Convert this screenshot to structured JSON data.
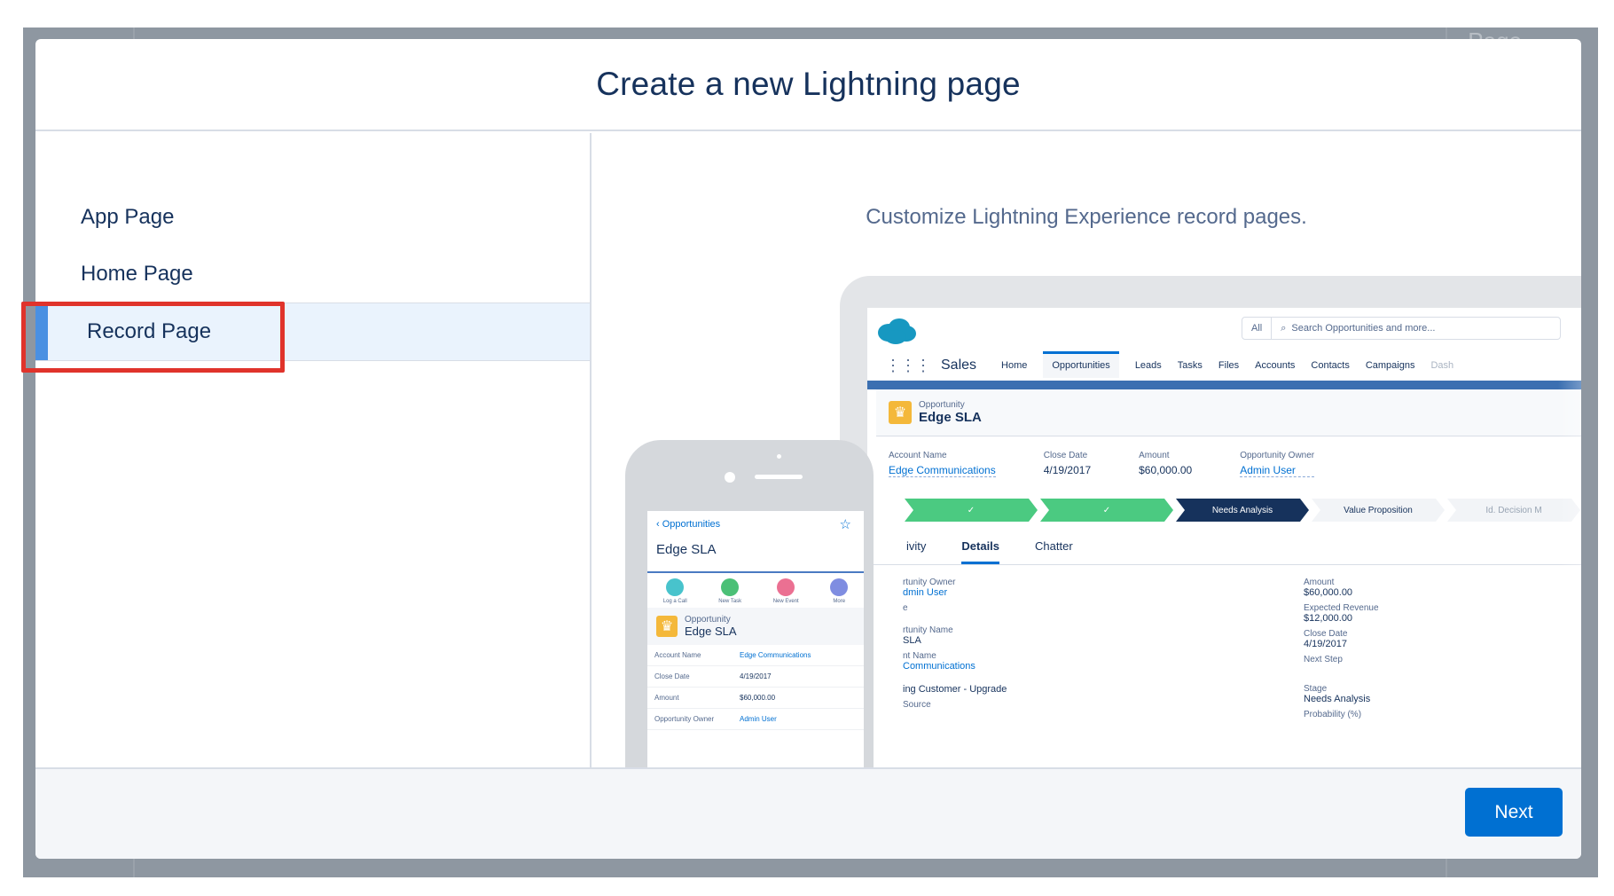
{
  "modal": {
    "title": "Create a new Lightning page",
    "background_partial_text": "Page"
  },
  "nav": {
    "items": [
      {
        "label": "App Page",
        "selected": false
      },
      {
        "label": "Home Page",
        "selected": false
      },
      {
        "label": "Record Page",
        "selected": true
      }
    ]
  },
  "preview": {
    "description": "Customize Lightning Experience record pages.",
    "desktop": {
      "search_scope": "All",
      "search_placeholder": "Search Opportunities and more...",
      "app_name": "Sales",
      "tabs": [
        "Home",
        "Opportunities",
        "Leads",
        "Tasks",
        "Files",
        "Accounts",
        "Contacts",
        "Campaigns",
        "Dash"
      ],
      "record_type": "Opportunity",
      "record_name": "Edge SLA",
      "highlight_fields": [
        {
          "label": "Account Name",
          "value": "Edge Communications"
        },
        {
          "label": "Close Date",
          "value": "4/19/2017"
        },
        {
          "label": "Amount",
          "value": "$60,000.00"
        },
        {
          "label": "Opportunity Owner",
          "value": "Admin User"
        }
      ],
      "path": [
        {
          "label": "✓",
          "state": "done"
        },
        {
          "label": "✓",
          "state": "done"
        },
        {
          "label": "Needs Analysis",
          "state": "current"
        },
        {
          "label": "Value Proposition",
          "state": "todo"
        },
        {
          "label": "Id. Decision M",
          "state": "todo"
        }
      ],
      "detail_tabs": [
        "ivity",
        "Details",
        "Chatter"
      ],
      "left_fields": [
        {
          "label": "rtunity Owner",
          "value": "dmin User"
        },
        {
          "label": "e",
          "value": ""
        },
        {
          "label": "rtunity Name",
          "value": "SLA"
        },
        {
          "label": "nt Name",
          "value": "Communications"
        },
        {
          "label": "",
          "value": "ing Customer - Upgrade"
        },
        {
          "label": "Source",
          "value": ""
        }
      ],
      "right_fields": [
        {
          "label": "Amount",
          "value": "$60,000.00"
        },
        {
          "label": "Expected Revenue",
          "value": "$12,000.00"
        },
        {
          "label": "Close Date",
          "value": "4/19/2017"
        },
        {
          "label": "Next Step",
          "value": ""
        },
        {
          "label": "Stage",
          "value": "Needs Analysis"
        },
        {
          "label": "Probability (%)",
          "value": ""
        }
      ]
    },
    "phone": {
      "back_label": "Opportunities",
      "title": "Edge SLA",
      "actions": [
        {
          "label": "Log a Call",
          "color": "#48c3cc"
        },
        {
          "label": "New Task",
          "color": "#4bc076"
        },
        {
          "label": "New Event",
          "color": "#eb7092"
        },
        {
          "label": "More",
          "color": "#7f8de1"
        }
      ],
      "record_type": "Opportunity",
      "record_name": "Edge SLA",
      "rows": [
        {
          "label": "Account Name",
          "value": "Edge Communications"
        },
        {
          "label": "Close Date",
          "value": "4/19/2017"
        },
        {
          "label": "Amount",
          "value": "$60,000.00"
        },
        {
          "label": "Opportunity Owner",
          "value": "Admin User"
        }
      ]
    }
  },
  "footer": {
    "next_label": "Next"
  },
  "colors": {
    "brand": "#0070d2",
    "title": "#16325c",
    "selected_bg": "#eaf3fd",
    "selected_bar": "#4a90e2",
    "highlight": "#e0332b"
  }
}
